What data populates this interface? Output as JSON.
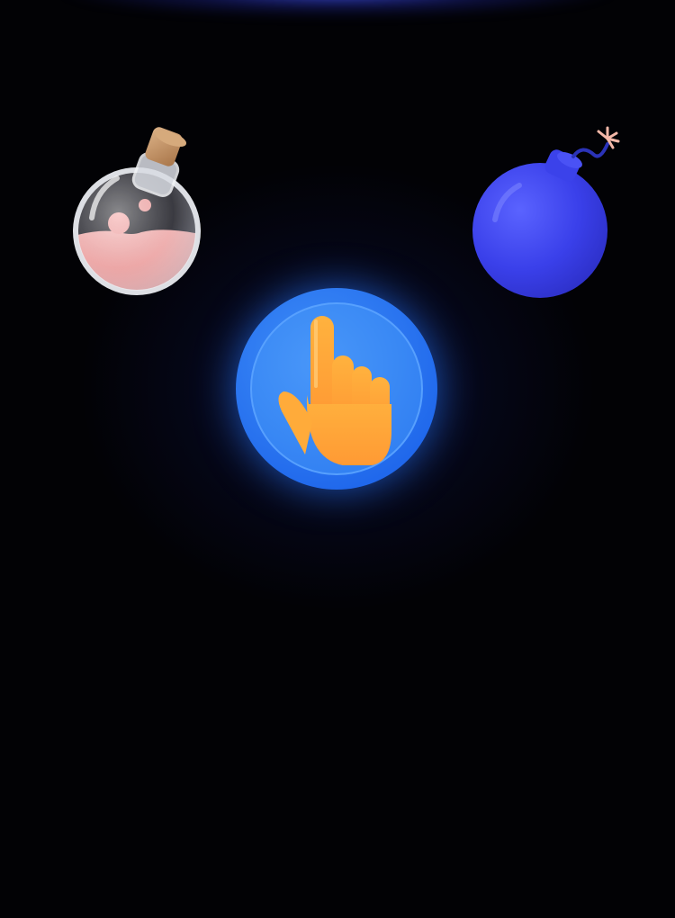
{
  "screen": {
    "background_color": "#020205",
    "glow_color": "#3b4cff"
  },
  "items": {
    "potion": {
      "icon": "potion-flask-icon",
      "liquid_color": "#f49a98",
      "cork_color": "#c89a6a"
    },
    "bomb": {
      "icon": "bomb-icon",
      "color": "#3a3fe8"
    }
  },
  "tap_button": {
    "icon": "pointing-hand-icon",
    "outer_color": "#1f6cf2",
    "inner_color": "#3b8cf7",
    "hand_color": "#ffa634"
  }
}
